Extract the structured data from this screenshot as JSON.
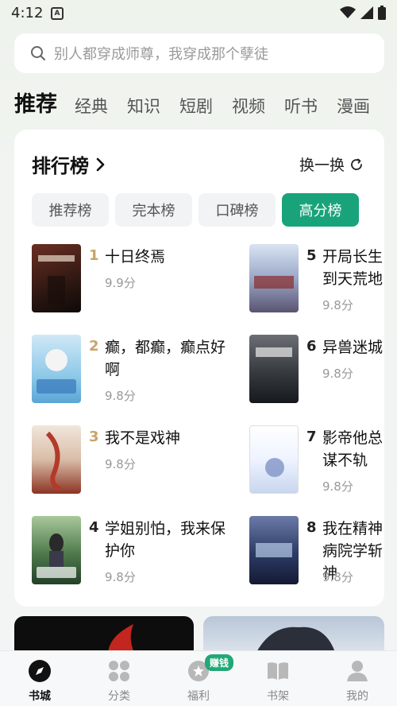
{
  "status": {
    "time": "4:12",
    "notif": "A"
  },
  "search": {
    "placeholder": "别人都穿成师尊，我穿成那个孽徒"
  },
  "categories": [
    {
      "label": "推荐",
      "active": true
    },
    {
      "label": "经典"
    },
    {
      "label": "知识"
    },
    {
      "label": "短剧"
    },
    {
      "label": "视频"
    },
    {
      "label": "听书"
    },
    {
      "label": "漫画"
    }
  ],
  "ranking": {
    "title": "排行榜",
    "refresh_label": "换一换",
    "tabs": [
      {
        "label": "推荐榜"
      },
      {
        "label": "完本榜"
      },
      {
        "label": "口碑榜"
      },
      {
        "label": "高分榜",
        "active": true
      }
    ],
    "books": [
      {
        "rank": "1",
        "title": "十日终焉",
        "score": "9.9分",
        "cover_color": "#3a1e1a"
      },
      {
        "rank": "2",
        "title": "癫，都癫，癫点好啊",
        "score": "9.8分",
        "cover_color": "#8ec9e8"
      },
      {
        "rank": "3",
        "title": "我不是戏神",
        "score": "9.8分",
        "cover_color": "#b33a2a"
      },
      {
        "rank": "4",
        "title": "学姐别怕，我来保护你",
        "score": "9.8分",
        "cover_color": "#2f5a3a"
      },
      {
        "rank": "5",
        "title": "开局长生到天荒地",
        "score": "9.8分",
        "cover_color": "#9aa8c8"
      },
      {
        "rank": "6",
        "title": "异兽迷城",
        "score": "9.8分",
        "cover_color": "#3b3f44"
      },
      {
        "rank": "7",
        "title": "影帝他总谋不轨",
        "score": "9.8分",
        "cover_color": "#eef3ff"
      },
      {
        "rank": "8",
        "title": "我在精神病院学斩神",
        "score": "9.8分",
        "cover_color": "#2c3b66"
      }
    ]
  },
  "bottom_nav": [
    {
      "label": "书城",
      "icon": "compass-icon",
      "active": true
    },
    {
      "label": "分类",
      "icon": "grid-icon"
    },
    {
      "label": "福利",
      "icon": "coin-icon",
      "badge": "赚钱"
    },
    {
      "label": "书架",
      "icon": "bookshelf-icon"
    },
    {
      "label": "我的",
      "icon": "profile-icon"
    }
  ],
  "colors": {
    "accent": "#19a37a",
    "rank_gold": "#c9a469",
    "rank_default": "#222222"
  }
}
